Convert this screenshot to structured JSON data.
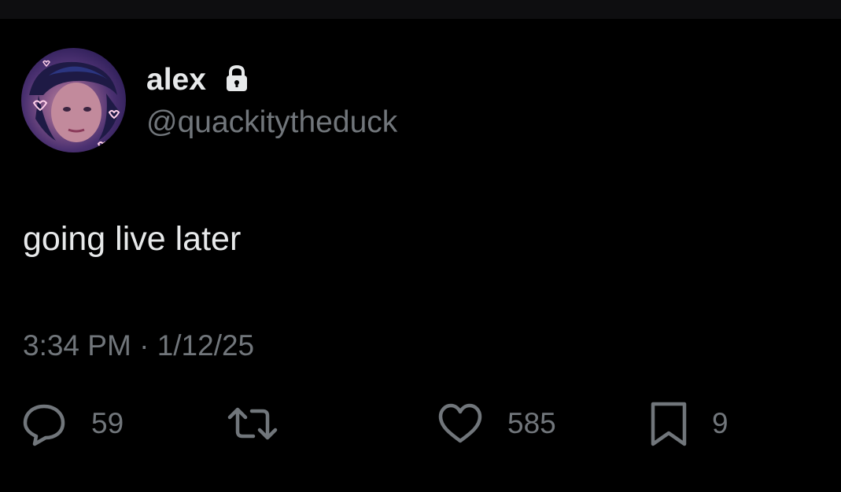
{
  "author": {
    "display_name": "alex",
    "handle": "@quackitytheduck",
    "protected": true,
    "avatar_icon": "avatar-photo"
  },
  "tweet": {
    "text": "going live later",
    "time": "3:34 PM",
    "separator": "·",
    "date": "1/12/25"
  },
  "actions": {
    "reply_count": "59",
    "retweet_count": "",
    "like_count": "585",
    "bookmark_count": "9"
  },
  "colors": {
    "background": "#000000",
    "primary_text": "#e7e9ea",
    "secondary_text": "#71767b"
  }
}
